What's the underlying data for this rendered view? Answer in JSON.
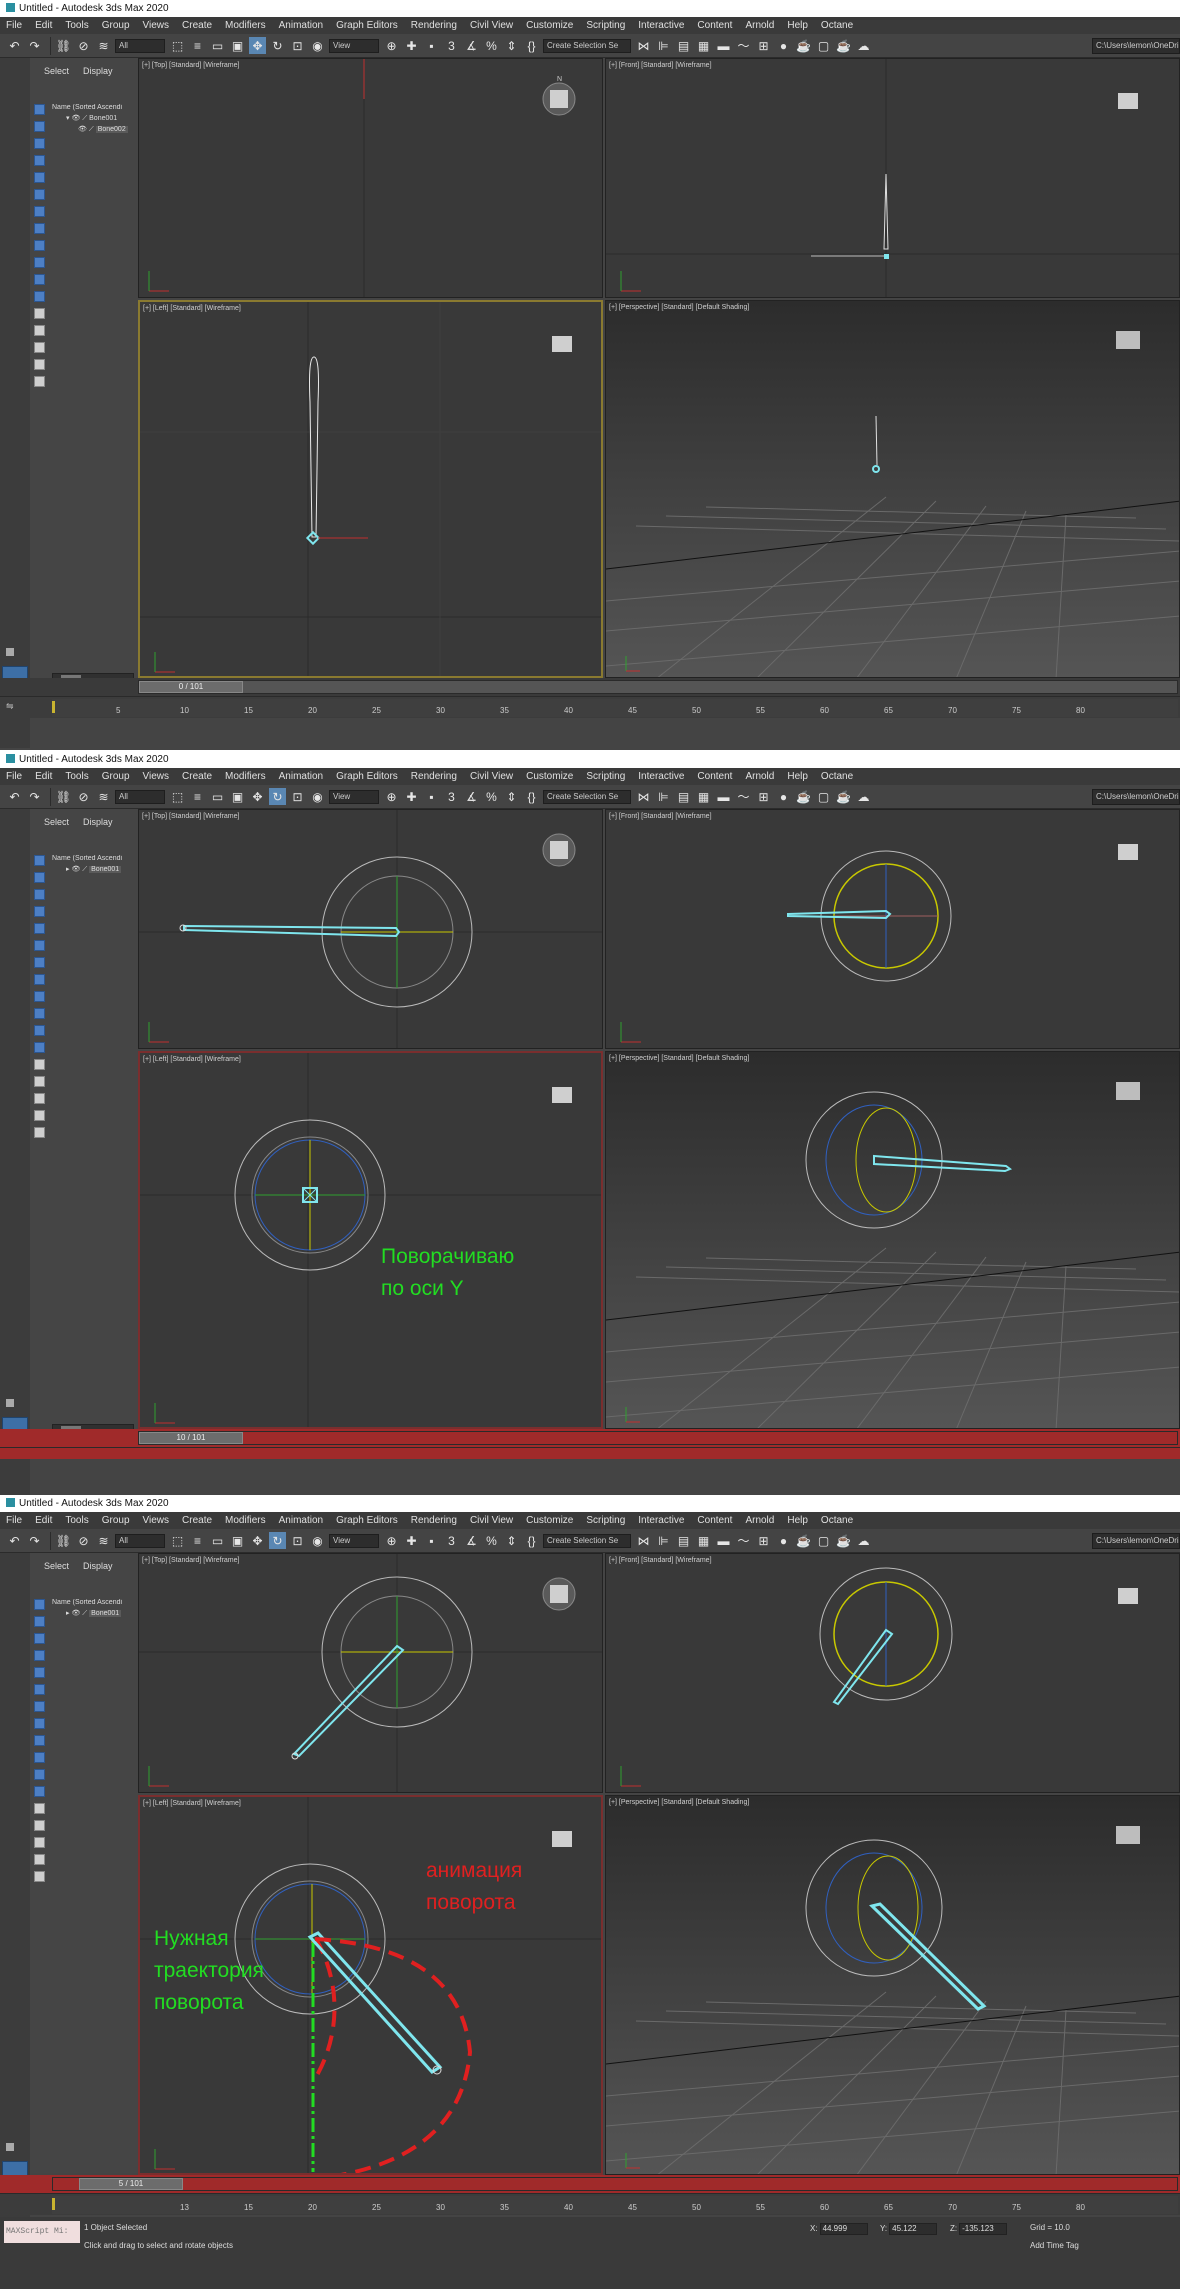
{
  "window": {
    "title": "Untitled - Autodesk 3ds Max 2020"
  },
  "menu": [
    "File",
    "Edit",
    "Tools",
    "Group",
    "Views",
    "Create",
    "Modifiers",
    "Animation",
    "Graph Editors",
    "Rendering",
    "Civil View",
    "Customize",
    "Scripting",
    "Interactive",
    "Content",
    "Arnold",
    "Help",
    "Octane"
  ],
  "toolbar": {
    "filter": "All",
    "view_select": "View",
    "selection_set": "Create Selection Se",
    "path": "C:\\Users\\lemon\\OneDri"
  },
  "explorer": {
    "tab_select": "Select",
    "tab_display": "Display",
    "header": "Name (Sorted Ascendi",
    "bone_parent": "Bone001",
    "bone_child": "Bone002",
    "bone_rotated": "Bone001"
  },
  "viewports": {
    "top": "[+] [Top] [Standard] [Wireframe]",
    "front": "[+] [Front] [Standard] [Wireframe]",
    "left": "[+] [Left] [Standard] [Wireframe]",
    "perspective": "[+] [Perspective] [Standard] [Default Shading]"
  },
  "panels": [
    {
      "frame": "0 / 101",
      "frame_value": 0,
      "ruler": [
        "5",
        "10",
        "15",
        "20",
        "25",
        "30",
        "35",
        "40",
        "45",
        "50",
        "55",
        "60",
        "65",
        "70",
        "75",
        "80"
      ]
    },
    {
      "frame": "10 / 101",
      "frame_value": 10,
      "ruler": []
    },
    {
      "frame": "5 / 101",
      "frame_value": 5,
      "ruler": [
        "13",
        "15",
        "20",
        "25",
        "30",
        "35",
        "40",
        "45",
        "50",
        "55",
        "60",
        "65",
        "70",
        "75",
        "80"
      ]
    }
  ],
  "annotations": {
    "rotate_y": [
      "Поворачиваю",
      "по оси Y"
    ],
    "anim_rotation": [
      "анимация",
      "поворота"
    ],
    "needed_path": [
      "Нужная",
      "траектория",
      "поворота"
    ]
  },
  "status": {
    "selected": "1 Object Selected",
    "hint": "Click and drag to select and rotate objects",
    "maxscript": "MAXScript Mi:",
    "x_label": "X:",
    "x": "44.999",
    "y_label": "Y:",
    "y": "45.122",
    "z_label": "Z:",
    "z": "-135.123",
    "grid": "Grid = 10.0",
    "time_tag": "Add Time Tag"
  },
  "colors": {
    "bone": "#7fe6ee",
    "green_note": "#22dd22",
    "red_note": "#e02020",
    "timeline_active": "#a02a2a"
  }
}
